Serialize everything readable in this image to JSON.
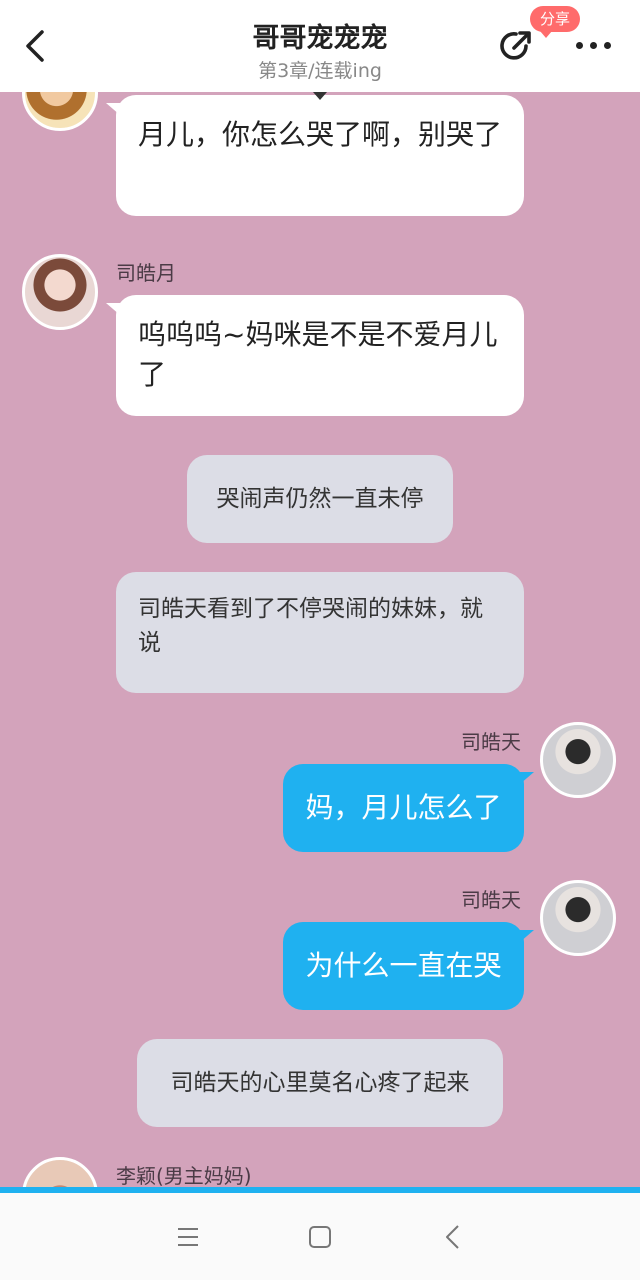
{
  "header": {
    "title": "哥哥宠宠宠",
    "subtitle": "第3章/连载ing",
    "share_badge": "分享"
  },
  "messages": {
    "m1": {
      "text": "月儿，你怎么哭了啊，别哭了"
    },
    "m2": {
      "sender": "司皓月",
      "text": "呜呜呜~妈咪是不是不爱月儿了"
    },
    "n1": {
      "text": "哭闹声仍然一直未停"
    },
    "n2": {
      "text": "司皓天看到了不停哭闹的妹妹，就说"
    },
    "m3": {
      "sender": "司皓天",
      "text": "妈，月儿怎么了"
    },
    "m4": {
      "sender": "司皓天",
      "text": "为什么一直在哭"
    },
    "n3": {
      "text": "司皓天的心里莫名心疼了起来"
    },
    "m5": {
      "sender": "李颖(男主妈妈)"
    }
  },
  "colors": {
    "background": "#d3a3bb",
    "accent_blue": "#1fb1f0",
    "badge_red": "#ff6b6b",
    "narration_gray": "#dcdde6"
  },
  "icons": {
    "back": "chevron-left-icon",
    "share": "share-arrow-icon",
    "more": "more-dots-icon",
    "nav_menu": "menu-icon",
    "nav_home": "home-square-icon",
    "nav_back": "nav-back-icon"
  }
}
